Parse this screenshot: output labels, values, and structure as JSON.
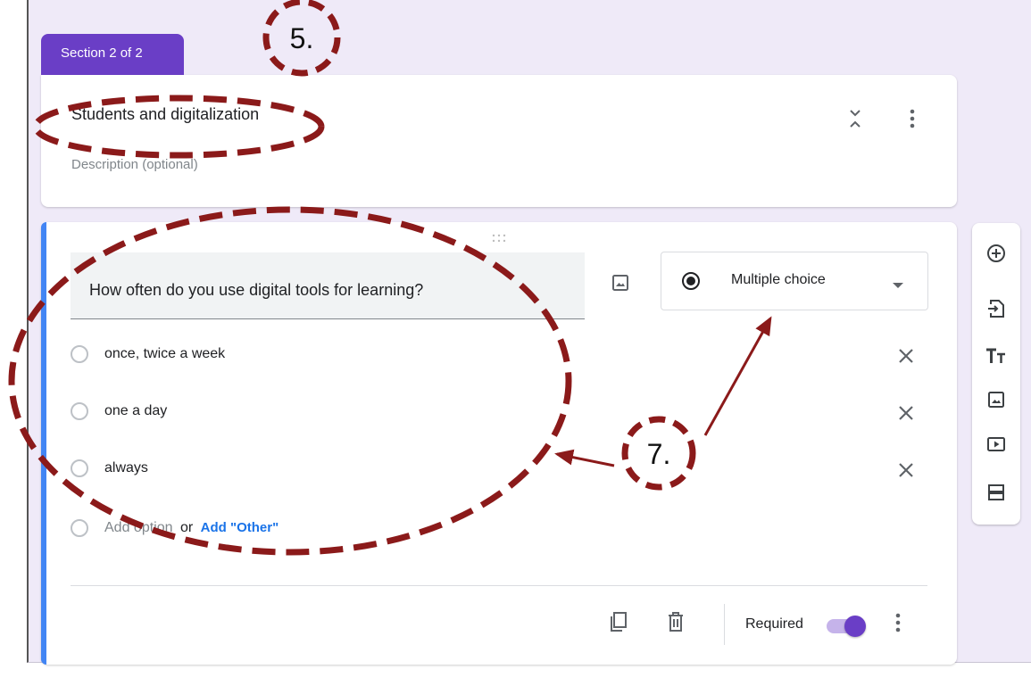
{
  "section": {
    "tab_label": "Section 2 of 2",
    "title": "Students and digitalization",
    "description_placeholder": "Description (optional)"
  },
  "question": {
    "text": "How often do you use digital tools for learning?",
    "type": "Multiple choice",
    "options": [
      "once, twice a week",
      "one a day",
      "always"
    ],
    "add_option": "Add option",
    "or_text": "or",
    "add_other": "Add \"Other\"",
    "required_label": "Required",
    "required": true
  },
  "annotations": {
    "label_5": "5.",
    "label_7": "7."
  },
  "colors": {
    "accent_purple": "#6a3ec6",
    "accent_blue": "#4285f4",
    "annotation": "#8b1a1a",
    "background": "#efeaf8"
  },
  "icons": {
    "side_tools": [
      "add-question-icon",
      "import-questions-icon",
      "add-title-icon",
      "add-image-icon",
      "add-video-icon",
      "add-section-icon"
    ]
  }
}
